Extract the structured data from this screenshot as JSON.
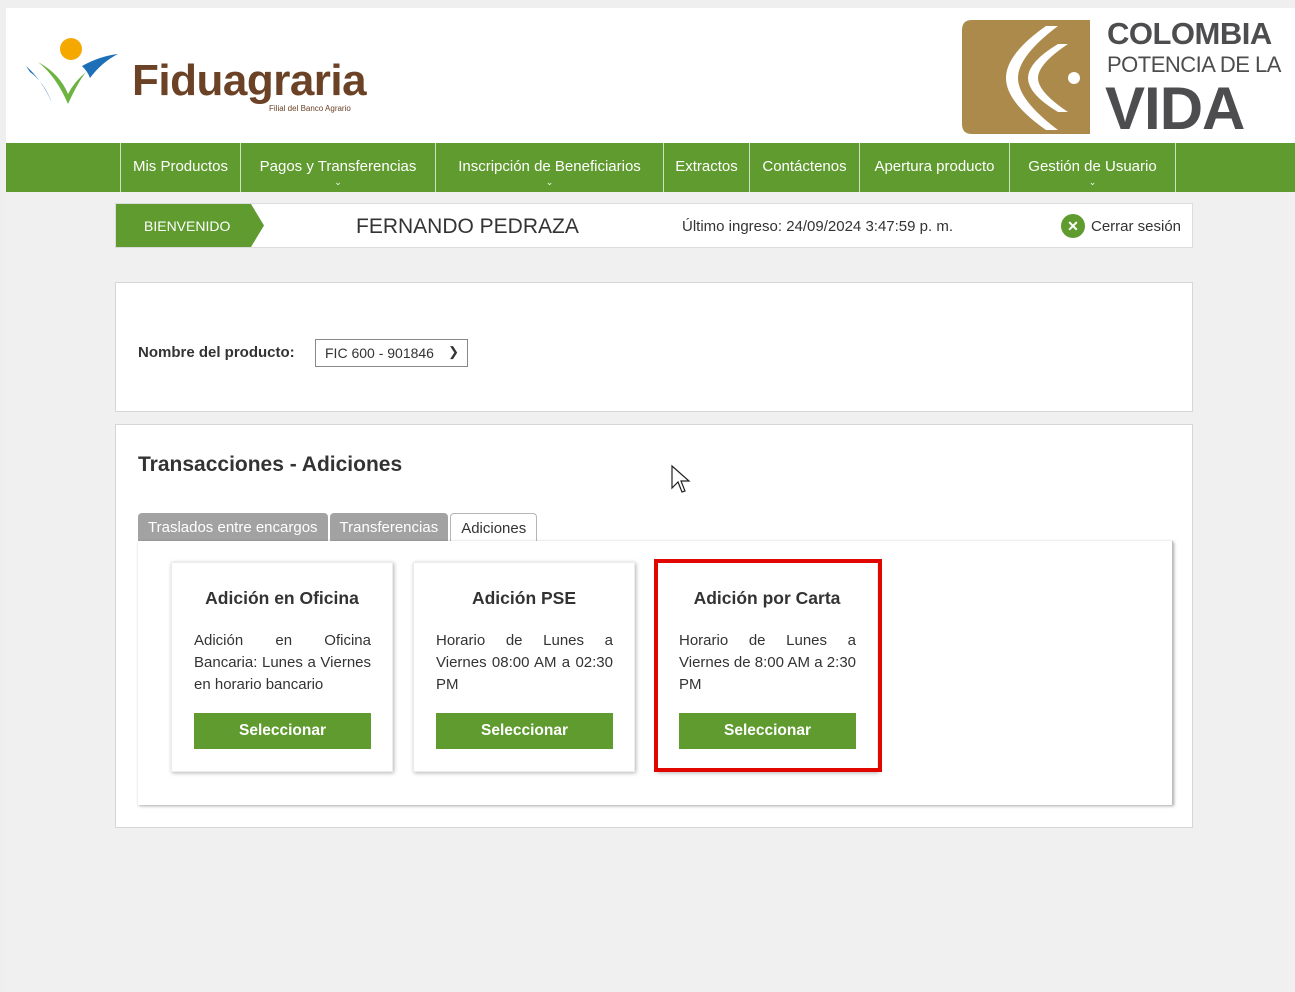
{
  "brand": {
    "logo_text": "Fiduagraria",
    "logo_subtitle": "Filial del Banco Agrario",
    "gov_line1": "COLOMBIA",
    "gov_line2": "POTENCIA DE LA",
    "gov_line3": "VIDA"
  },
  "nav": {
    "items": [
      {
        "label": "Mis Productos"
      },
      {
        "label": "Pagos y Transferencias"
      },
      {
        "label": "Inscripción de Beneficiarios"
      },
      {
        "label": "Extractos"
      },
      {
        "label": "Contáctenos"
      },
      {
        "label": "Apertura producto"
      },
      {
        "label": "Gestión de Usuario"
      }
    ]
  },
  "welcome": {
    "tag": "BIENVENIDO",
    "user": "FERNANDO PEDRAZA",
    "last_login": "Último ingreso: 24/09/2024 3:47:59 p. m.",
    "logout": "Cerrar sesión"
  },
  "product": {
    "label": "Nombre del producto:",
    "selected": "FIC 600 - 901846"
  },
  "transactions": {
    "title": "Transacciones - Adiciones",
    "tabs": [
      {
        "label": "Traslados entre encargos"
      },
      {
        "label": "Transferencias"
      },
      {
        "label": "Adiciones"
      }
    ],
    "cards": [
      {
        "title": "Adición en Oficina",
        "text": "Adición en Oficina Bancaria: Lunes a Viernes en horario bancario",
        "button": "Seleccionar"
      },
      {
        "title": "Adición PSE",
        "text": "Horario de Lunes a Viernes 08:00 AM a 02:30 PM",
        "button": "Seleccionar"
      },
      {
        "title": "Adición por Carta",
        "text": "Horario de Lunes a Viernes de 8:00 AM a 2:30 PM",
        "button": "Seleccionar"
      }
    ]
  },
  "colors": {
    "primary_green": "#5f9b2e",
    "brand_brown": "#6b4226",
    "highlight_red": "#e10600"
  }
}
